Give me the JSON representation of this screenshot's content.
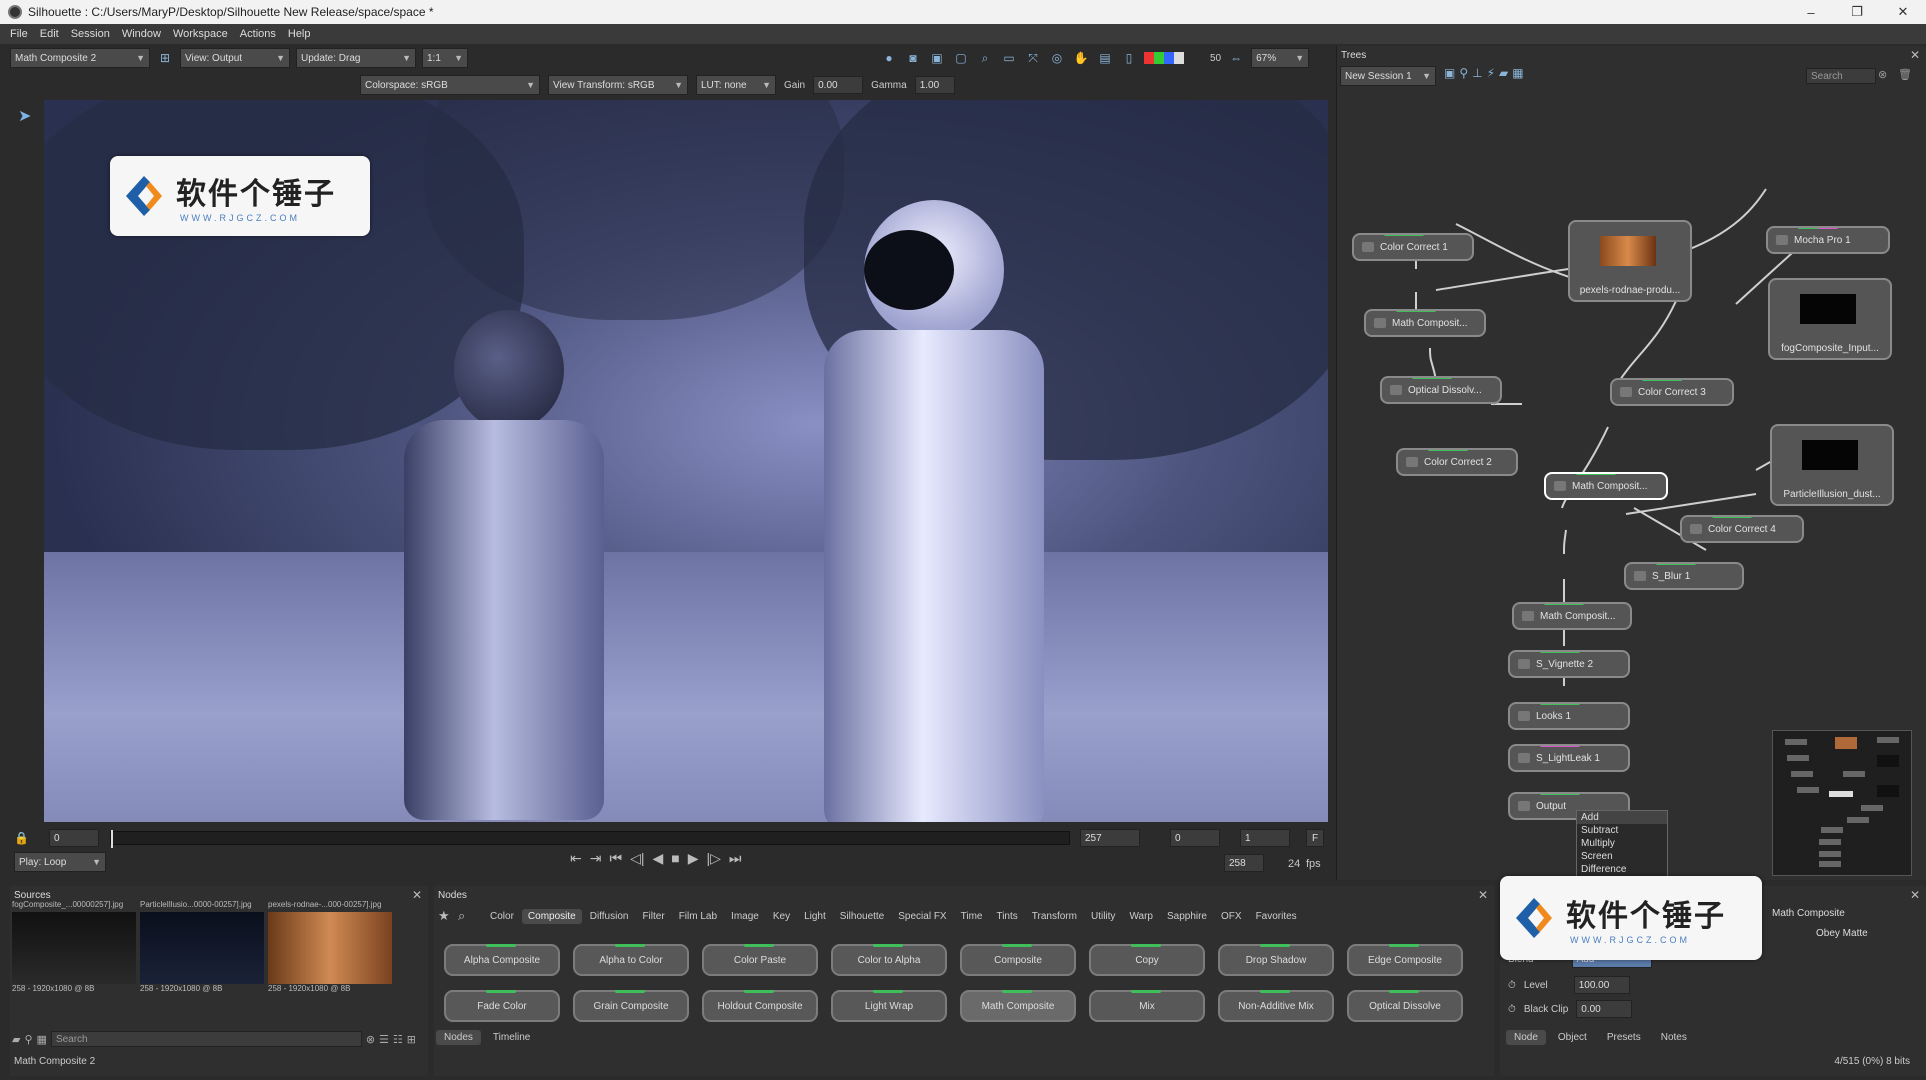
{
  "window": {
    "title": "Silhouette : C:/Users/MaryP/Desktop/Silhouette New Release/space/space *",
    "min": "–",
    "max": "❐",
    "close": "✕"
  },
  "menu": [
    "File",
    "Edit",
    "Session",
    "Window",
    "Workspace",
    "Actions",
    "Help"
  ],
  "viewer_toolbar": {
    "node_select": "Math Composite 2",
    "view": "View: Output",
    "update": "Update: Drag",
    "ratio": "1:1",
    "colorspace": "Colorspace: sRGB",
    "view_transform": "View Transform: sRGB",
    "lut": "LUT: none",
    "gain_label": "Gain",
    "gain_value": "0.00",
    "gamma_label": "Gamma",
    "gamma_value": "1.00",
    "num50": "50",
    "zoom": "67%"
  },
  "logo": {
    "text": "软件个锤子",
    "url": "WWW.RJGCZ.COM"
  },
  "timeline": {
    "start": "0",
    "end_frame": "257",
    "in_frame": "0",
    "step": "1",
    "f_btn": "F",
    "play_mode": "Play: Loop",
    "frame_count": "258",
    "fps_value": "24",
    "fps_label": "fps"
  },
  "trees": {
    "title": "Trees",
    "session": "New Session 1",
    "search_placeholder": "Search",
    "nodes": [
      "Color Correct 1",
      "Math Composit...",
      "Optical Dissolv...",
      "Color Correct 2",
      "Math Composit...",
      "Color Correct 3",
      "Mocha Pro 1",
      "Color Correct 4",
      "S_Blur 1",
      "Math Composit...",
      "S_Vignette 2",
      "Looks 1",
      "S_LightLeak 1",
      "Output"
    ],
    "thumb_nodes": [
      "pexels-rodnae-produ...",
      "fogComposite_Input...",
      "ParticleIllusion_dust..."
    ]
  },
  "blend_dropdown": [
    "Add",
    "Subtract",
    "Multiply",
    "Screen",
    "Difference"
  ],
  "sources": {
    "title": "Sources",
    "items": [
      {
        "name": "fogComposite_...00000257].jpg",
        "info": "258 - 1920x1080 @ 8B"
      },
      {
        "name": "ParticleIllusio...0000-00257].jpg",
        "info": "258 - 1920x1080 @ 8B"
      },
      {
        "name": "pexels-rodnae-...000-00257].jpg",
        "info": "258 - 1920x1080 @ 8B"
      }
    ],
    "search_placeholder": "Search"
  },
  "nodes_panel": {
    "title": "Nodes",
    "categories": [
      "Color",
      "Composite",
      "Diffusion",
      "Filter",
      "Film Lab",
      "Image",
      "Key",
      "Light",
      "Silhouette",
      "Special FX",
      "Time",
      "Tints",
      "Transform",
      "Utility",
      "Warp",
      "Sapphire",
      "OFX",
      "Favorites"
    ],
    "active_category": "Composite",
    "buttons": [
      "Alpha Composite",
      "Alpha to Color",
      "Color Paste",
      "Color to Alpha",
      "Composite",
      "Copy",
      "Drop Shadow",
      "Edge Composite",
      "Fade Color",
      "Grain Composite",
      "Holdout Composite",
      "Light Wrap",
      "Math Composite",
      "Mix",
      "Non-Additive Mix",
      "Optical Dissolve"
    ],
    "tabs": [
      "Nodes",
      "Timeline"
    ]
  },
  "object_panel": {
    "node_name": "Math Composite",
    "obey_matte": "Obey Matte",
    "blend_label": "Blend",
    "blend_value": "Add",
    "level_label": "Level",
    "level_value": "100.00",
    "black_clip_label": "Black Clip",
    "black_clip_value": "0.00",
    "tabs": [
      "Node",
      "Object",
      "Presets",
      "Notes"
    ]
  },
  "status": {
    "left": "Math Composite 2",
    "right": "4/515 (0%) 8 bits"
  }
}
